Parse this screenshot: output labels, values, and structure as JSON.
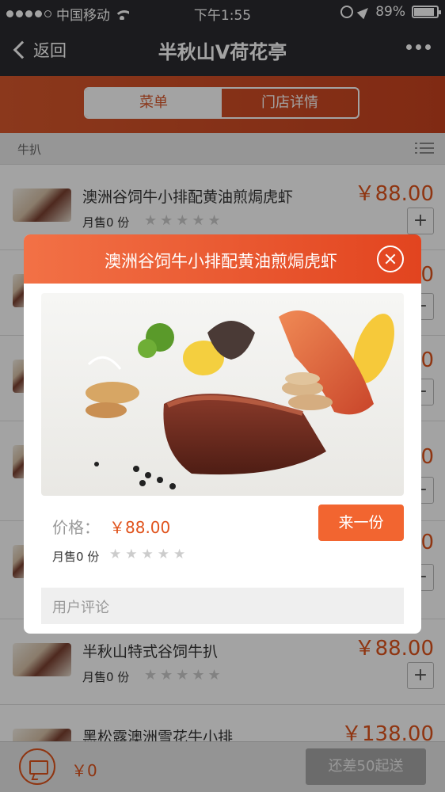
{
  "status_bar": {
    "carrier": "中国移动",
    "time": "下午1:55",
    "battery": "89%"
  },
  "nav": {
    "back_label": "返回",
    "title": "半秋山V荷花亭"
  },
  "tabs": {
    "menu": "菜单",
    "store": "门店详情"
  },
  "category": {
    "name": "牛扒"
  },
  "items": [
    {
      "name": "澳洲谷饲牛小排配黄油煎焗虎虾",
      "sold": "月售0 份",
      "price": "￥88.00",
      "plus": "+"
    },
    {
      "name": "",
      "sold": "",
      "price": "",
      "plus": "+"
    },
    {
      "name": "",
      "sold": "",
      "price": "",
      "plus": "+"
    },
    {
      "name": "",
      "sold": "",
      "price": "",
      "plus": "+"
    },
    {
      "name": "",
      "sold": "",
      "price": "",
      "plus": "+"
    },
    {
      "name": "半秋山特式谷饲牛扒",
      "sold": "月售0 份",
      "price": "￥88.00",
      "plus": "+"
    },
    {
      "name": "黑松露澳洲雪花牛小排",
      "sold": "",
      "price": "￥138.00",
      "plus": "+"
    }
  ],
  "partial_prices": [
    "0",
    "0",
    "0",
    "0",
    "0"
  ],
  "modal": {
    "title": "澳洲谷饲牛小排配黄油煎焗虎虾",
    "price_label": "价格：",
    "price": "￥88.00",
    "order_button": "来一份",
    "sold": "月售0 份",
    "reviews_label": "用户评论"
  },
  "bottom_bar": {
    "total": "￥0",
    "min_order_button": "还差50起送"
  },
  "stars": "★★★★★",
  "colors": {
    "accent": "#e0531c",
    "nav_bg": "#2b2b2f"
  }
}
